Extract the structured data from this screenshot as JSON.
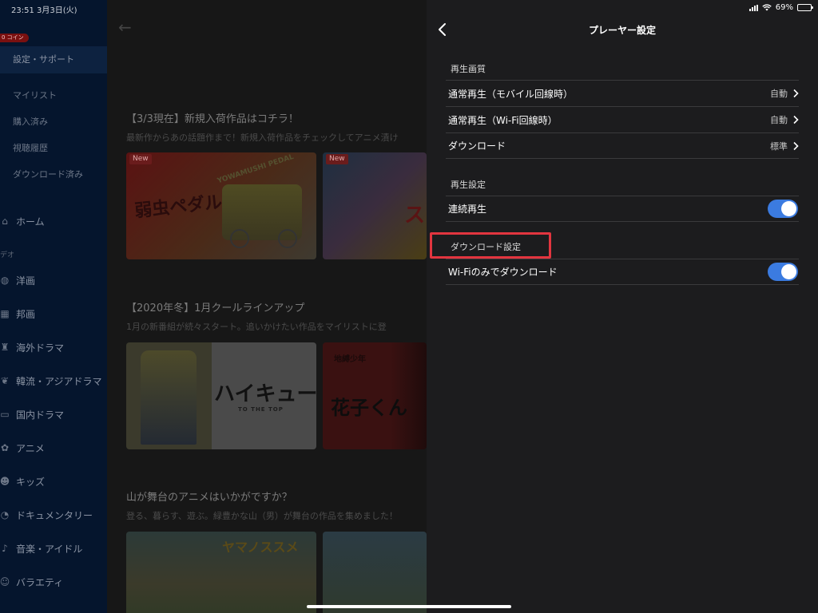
{
  "status": {
    "time_date": "23:51 3月3日(火)",
    "battery": "69%",
    "battery_level": 0.69
  },
  "sidebar": {
    "coin_badge": "0 コイン",
    "active_item": "設定・サポート",
    "sub_items": [
      "マイリスト",
      "購入済み",
      "視聴履歴",
      "ダウンロード済み"
    ],
    "home": "ホーム",
    "category_label": "デオ",
    "nav_items": [
      "洋画",
      "邦画",
      "海外ドラマ",
      "韓流・アジアドラマ",
      "国内ドラマ",
      "アニメ",
      "キッズ",
      "ドキュメンタリー",
      "音楽・アイドル",
      "バラエティ"
    ]
  },
  "main": {
    "sections": [
      {
        "title": "【3/3現在】新規入荷作品はコチラ！",
        "desc": "最新作からあの話題作まで！新規入荷作品をチェックしてアニメ漬け",
        "thumbs": [
          {
            "badge": "New",
            "title": "弱虫ペダル",
            "subtitle": "YOWAMUSHI PEDAL"
          },
          {
            "badge": "New",
            "title": "ス"
          }
        ]
      },
      {
        "title": "【2020年冬】1月クールラインアップ",
        "desc": "1月の新番組が続々スタート。追いかけたい作品をマイリストに登",
        "thumbs": [
          {
            "title": "ハイキュー!!",
            "subtitle": "TO THE TOP"
          },
          {
            "title": "花子くん",
            "subtitle": "地縛少年"
          }
        ]
      },
      {
        "title": "山が舞台のアニメはいかがですか？",
        "desc": "登る、暮らす、遊ぶ。緑豊かな山（男）が舞台の作品を集めました！",
        "thumbs": [
          {
            "title": "ヤマノススメ"
          },
          {
            "title": ""
          }
        ]
      }
    ]
  },
  "panel": {
    "title": "プレーヤー設定",
    "groups": [
      {
        "label": "再生画質",
        "rows": [
          {
            "label": "通常再生（モバイル回線時）",
            "value": "自動"
          },
          {
            "label": "通常再生（Wi-Fi回線時）",
            "value": "自動"
          },
          {
            "label": "ダウンロード",
            "value": "標準"
          }
        ]
      },
      {
        "label": "再生設定",
        "rows": [
          {
            "label": "連続再生",
            "toggle": true
          }
        ]
      },
      {
        "label": "ダウンロード設定",
        "rows": [
          {
            "label": "Wi-Fiのみでダウンロード",
            "toggle": true
          }
        ]
      }
    ]
  },
  "colors": {
    "accent_toggle": "#3b7be0",
    "highlight": "#e2353f"
  }
}
